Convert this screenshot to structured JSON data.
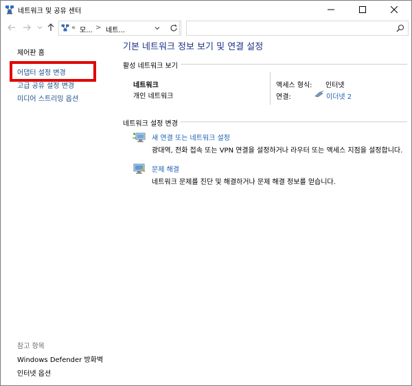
{
  "window": {
    "title": "네트워크 및 공유 센터"
  },
  "nav": {
    "breadcrumb_overflow": "«",
    "crumb1": "모...",
    "crumb_sep": ">",
    "crumb2": "네트..."
  },
  "left_pane": {
    "home": "제어판 홈",
    "change_adapter": "어댑터 설정 변경",
    "advanced_sharing": "고급 공유 설정 변경",
    "media_streaming": "미디어 스트리밍 옵션",
    "see_also": "참고 항목",
    "defender_firewall": "Windows Defender 방화벽",
    "internet_options": "인터넷 옵션"
  },
  "main": {
    "title": "기본 네트워크 정보 보기 및 연결 설정",
    "active_networks_label": "활성 네트워크 보기",
    "network": {
      "name": "네트워크",
      "type": "개인 네트워크",
      "access_type_label": "액세스 형식:",
      "access_type_value": "인터넷",
      "connection_label": "연결:",
      "connection_value": "이더넷 2"
    },
    "change_settings_label": "네트워크 설정 변경",
    "tasks": [
      {
        "title": "새 연결 또는 네트워크 설정",
        "desc": "광대역, 전화 접속 또는 VPN 연결을 설정하거나 라우터 또는 액세스 지점을 설정합니다."
      },
      {
        "title": "문제 해결",
        "desc": "네트워크 문제를 진단 및 해결하거나 문제 해결 정보를 얻습니다."
      }
    ]
  },
  "colors": {
    "link": "#1a4f8a",
    "title": "#1e3287",
    "highlight": "#e00000"
  }
}
